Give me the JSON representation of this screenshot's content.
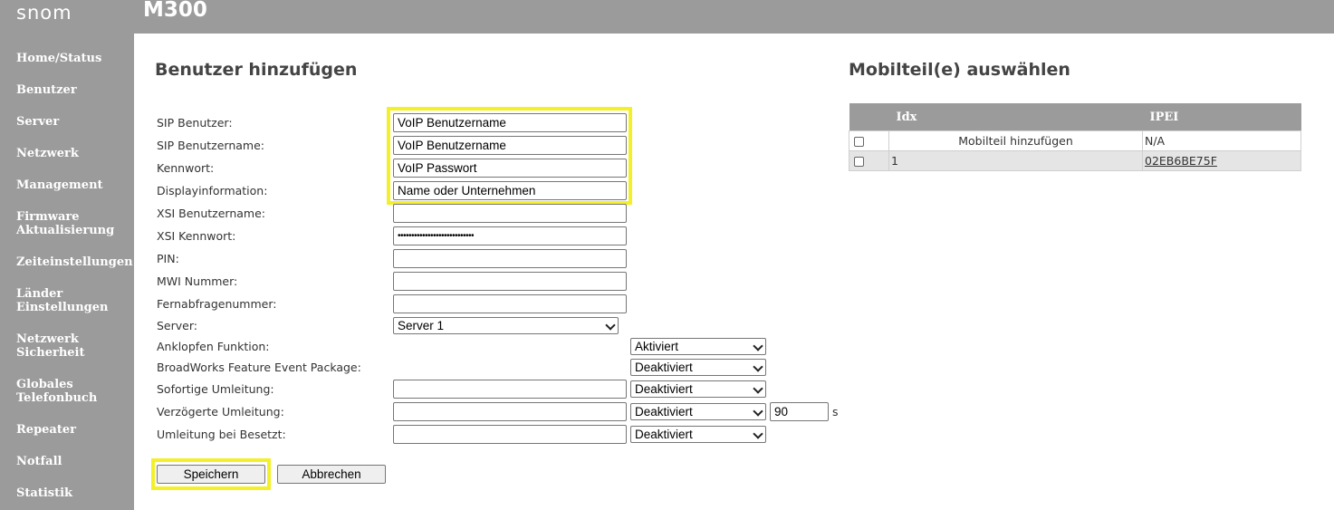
{
  "header": {
    "logo": "snom",
    "model": "M300"
  },
  "sidebar": {
    "items": [
      {
        "label": "Home/Status"
      },
      {
        "label": "Benutzer"
      },
      {
        "label": "Server"
      },
      {
        "label": "Netzwerk"
      },
      {
        "label": "Management"
      },
      {
        "label": "Firmware\nAktualisierung"
      },
      {
        "label": "Zeiteinstellungen"
      },
      {
        "label": "Länder\nEinstellungen"
      },
      {
        "label": "Netzwerk\nSicherheit"
      },
      {
        "label": "Globales\nTelefonbuch"
      },
      {
        "label": "Repeater"
      },
      {
        "label": "Notfall"
      },
      {
        "label": "Statistik"
      }
    ]
  },
  "form": {
    "title": "Benutzer hinzufügen",
    "fields": {
      "sip_user": {
        "label": "SIP Benutzer:",
        "value": "VoIP Benutzername"
      },
      "sip_username": {
        "label": "SIP Benutzername:",
        "value": "VoIP Benutzername"
      },
      "password": {
        "label": "Kennwort:",
        "value": "VoIP Passwort"
      },
      "display_info": {
        "label": "Displayinformation:",
        "value": "Name oder Unternehmen"
      },
      "xsi_username": {
        "label": "XSI Benutzername:",
        "value": ""
      },
      "xsi_password": {
        "label": "XSI Kennwort:",
        "value": "••••••••••••••••••••••••••••"
      },
      "pin": {
        "label": "PIN:",
        "value": ""
      },
      "mwi": {
        "label": "MWI Nummer:",
        "value": ""
      },
      "remote_query": {
        "label": "Fernabfragenummer:",
        "value": ""
      },
      "server": {
        "label": "Server:",
        "selected": "Server 1"
      },
      "call_waiting": {
        "label": "Anklopfen Funktion:",
        "selected": "Aktiviert"
      },
      "broadworks": {
        "label": "BroadWorks Feature Event Package:",
        "selected": "Deaktiviert"
      },
      "immediate_forward": {
        "label": "Sofortige Umleitung:",
        "value": "",
        "selected": "Deaktiviert"
      },
      "delayed_forward": {
        "label": "Verzögerte Umleitung:",
        "value": "",
        "selected": "Deaktiviert",
        "delay": "90",
        "unit": "s"
      },
      "busy_forward": {
        "label": "Umleitung bei Besetzt:",
        "value": "",
        "selected": "Deaktiviert"
      }
    },
    "buttons": {
      "save": "Speichern",
      "cancel": "Abbrechen"
    }
  },
  "handsets": {
    "title": "Mobilteil(e) auswählen",
    "columns": [
      "",
      "Idx",
      "IPEI"
    ],
    "rows": [
      {
        "checked": false,
        "idx": "Mobilteil hinzufügen",
        "ipei": "N/A"
      },
      {
        "checked": false,
        "idx": "1",
        "ipei": "02EB6BE75F"
      }
    ]
  },
  "colors": {
    "chrome": "#9b9b9b",
    "highlight": "#f3f02a"
  }
}
